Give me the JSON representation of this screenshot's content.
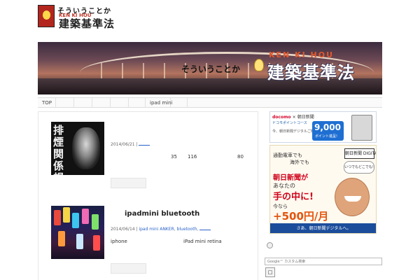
{
  "header": {
    "logo": {
      "top_text": "そういうことか",
      "sub_text": "KEN KI HOU",
      "main_text": "建築基準法"
    },
    "banner": {
      "top_text": "そういうことか",
      "sub_text": "KEN KI HOU",
      "main_text": "建築基準法"
    }
  },
  "nav": {
    "items": [
      "TOP",
      "",
      "",
      "",
      "",
      "",
      "ipad mini",
      ""
    ]
  },
  "posts": [
    {
      "thumbnail_text": "排煙関係規定",
      "date": "2014/06/21",
      "category_link": "",
      "excerpt_numbers": [
        "35",
        "116",
        "80"
      ]
    },
    {
      "title": "ipadmini bluetooth",
      "date": "2014/06/14",
      "tags": [
        "ipad mini",
        "ANKER",
        "bluetooth",
        ""
      ],
      "excerpt": [
        "iphone",
        "iPad mini retina"
      ]
    }
  ],
  "sidebar": {
    "ad1": {
      "brand": "docomo",
      "brand_x": "×",
      "brand_asahi": "朝日新聞",
      "point_label": "ドコモポイントコース",
      "sub": "今、朝日新聞デジタルご購読で…",
      "points": "9,000",
      "points_label": "ポイント進呈!"
    },
    "ad2": {
      "line1": "通勤電車でも",
      "line2": "海外でも",
      "logo": "朝日新聞 DIGITAL",
      "bubble": "いつでもどこでも!",
      "red1": "朝日新聞が",
      "plain": "あなたの",
      "red2": "手の中に!",
      "now": "今なら",
      "price": "+500円/月",
      "bar": "さあ、朝日新聞デジタルへ。"
    },
    "search": {
      "placeholder": "Google™ カスタム検索",
      "button_label": "□"
    }
  },
  "colors": {
    "link": "#2a62c9",
    "banner_accent": "#e2572b",
    "ad_red": "#d0021b",
    "ad_blue": "#1b4d9b"
  }
}
